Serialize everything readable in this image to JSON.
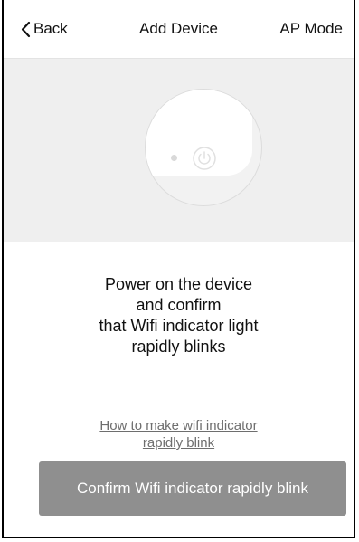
{
  "navbar": {
    "back_label": "Back",
    "title": "Add Device",
    "right_label": "AP Mode"
  },
  "illustration": {
    "icons": [
      "device-icon",
      "power-icon",
      "indicator-dot"
    ]
  },
  "instructions": {
    "line1": "Power on the device",
    "line2": "and confirm",
    "line3": "that Wifi indicator light",
    "line4": "rapidly blinks"
  },
  "help_link": {
    "line1": "How to make wifi indicator",
    "line2": "rapidly blink"
  },
  "confirm_button": {
    "label": "Confirm Wifi indicator rapidly blink"
  },
  "colors": {
    "hero_background": "#efefef",
    "button_background": "#8f8f8f",
    "link_text": "#6e6e6e"
  }
}
